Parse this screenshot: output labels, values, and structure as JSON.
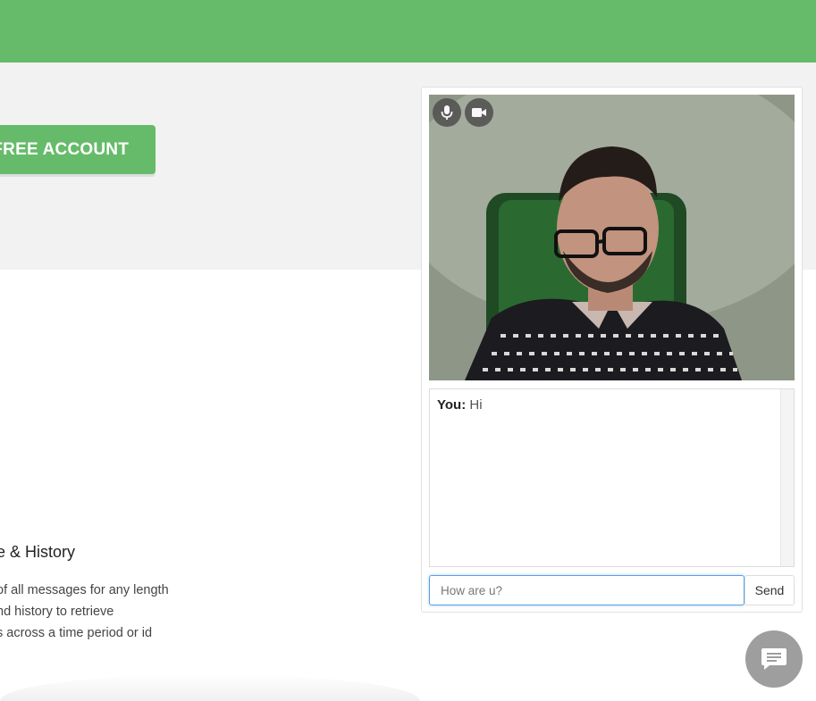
{
  "hero": {
    "cta_label": "FREE ACCOUNT"
  },
  "features": {
    "title": "e & History",
    "items": [
      "of all messages for any length",
      "nd history to retrieve",
      "s across a time period or id"
    ]
  },
  "demo": {
    "video_buttons": [
      "mic-icon",
      "video-camera-icon"
    ],
    "chat": {
      "messages": [
        {
          "sender": "You:",
          "text": "Hi"
        }
      ]
    },
    "input_value": "How are u?",
    "send_label": "Send"
  },
  "colors": {
    "brand_green": "#66bb6a",
    "hero_bg": "#f2f2f2",
    "fab_gray": "#9e9e9e"
  }
}
